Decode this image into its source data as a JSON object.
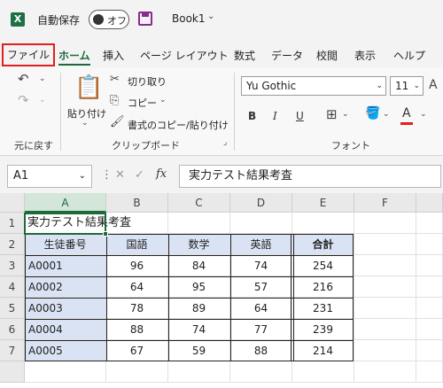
{
  "titlebar": {
    "logo": "X",
    "autosave_label": "自動保存",
    "autosave_state": "オフ",
    "book_title": "Book1",
    "chevron": "⌄"
  },
  "tabs": [
    "ファイル",
    "ホーム",
    "挿入",
    "ページ レイアウト",
    "数式",
    "データ",
    "校閲",
    "表示",
    "ヘルプ"
  ],
  "ribbon": {
    "undo_group_label": "元に戻す",
    "paste_label": "貼り付け",
    "cut_label": "切り取り",
    "copy_label": "コピー",
    "format_painter_label": "書式のコピー/貼り付け",
    "clipboard_group_label": "クリップボード",
    "font_name": "Yu Gothic",
    "font_size": "11",
    "bold": "B",
    "italic": "I",
    "underline": "U",
    "font_color_letter": "A",
    "font_group_label": "フォント"
  },
  "formula_bar": {
    "name_box": "A1",
    "fx": "fx",
    "value": "実力テスト結果考査"
  },
  "sheet": {
    "columns": [
      "A",
      "B",
      "C",
      "D",
      "E",
      "F"
    ],
    "rows": [
      "1",
      "2",
      "3",
      "4",
      "5",
      "6",
      "7"
    ],
    "title": "実力テスト結果考査",
    "headers": [
      "生徒番号",
      "国語",
      "数学",
      "英語",
      "合計"
    ],
    "data": [
      [
        "A0001",
        "96",
        "84",
        "74",
        "254"
      ],
      [
        "A0002",
        "64",
        "95",
        "57",
        "216"
      ],
      [
        "A0003",
        "78",
        "89",
        "64",
        "231"
      ],
      [
        "A0004",
        "88",
        "74",
        "77",
        "239"
      ],
      [
        "A0005",
        "67",
        "59",
        "88",
        "214"
      ]
    ]
  },
  "colors": {
    "excel_green": "#1d6b3a",
    "file_tab_highlight": "#e02020",
    "table_fill": "#dae3f3",
    "font_color_bar": "#e02020"
  }
}
